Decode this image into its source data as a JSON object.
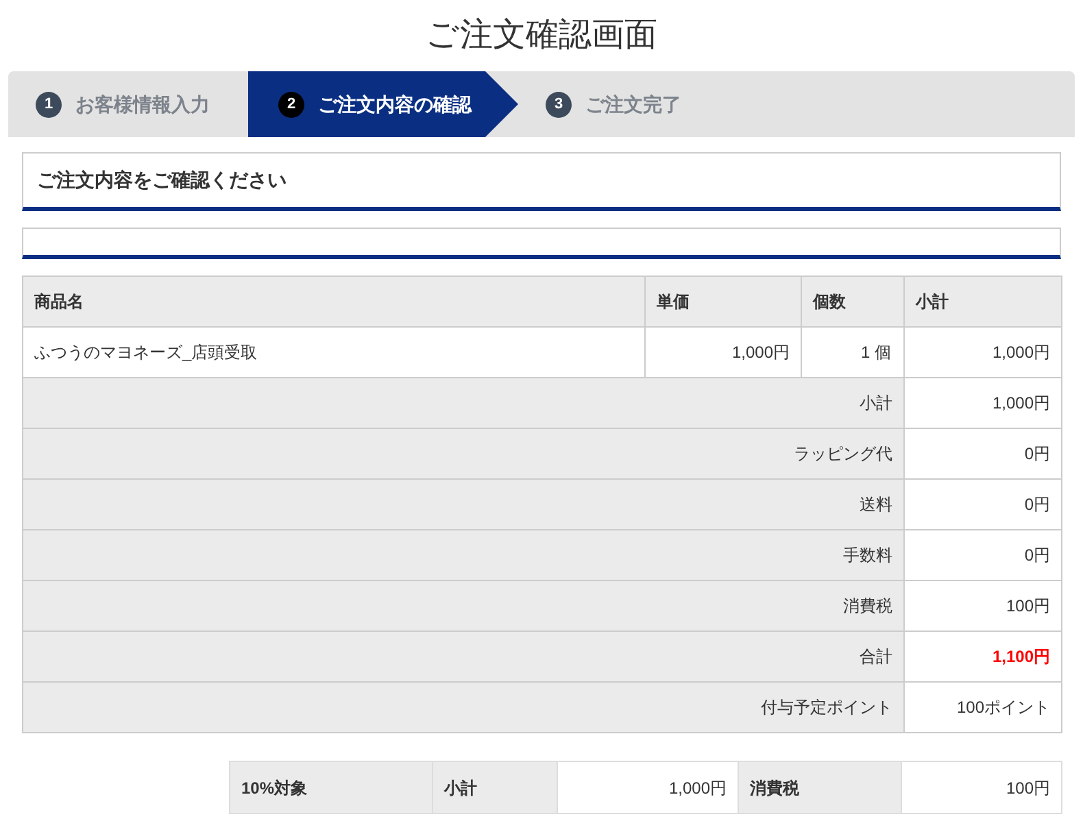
{
  "title": "ご注文確認画面",
  "steps": [
    {
      "number": "1",
      "label": "お客様情報入力",
      "selected": false
    },
    {
      "number": "2",
      "label": "ご注文内容の確認",
      "selected": true
    },
    {
      "number": "3",
      "label": "ご注文完了",
      "selected": false
    }
  ],
  "section_heading": "ご注文内容をご確認ください",
  "order_table": {
    "columns": [
      "商品名",
      "単価",
      "個数",
      "小計"
    ],
    "rows": [
      {
        "cells": [
          "ふつうのマヨネーズ_店頭受取",
          "1,000円",
          "1 個",
          "1,000円"
        ]
      }
    ],
    "summary": [
      {
        "label": "小計",
        "value": "1,000円",
        "emphasized": false
      },
      {
        "label": "ラッピング代",
        "value": "0円",
        "emphasized": false
      },
      {
        "label": "送料",
        "value": "0円",
        "emphasized": false
      },
      {
        "label": "手数料",
        "value": "0円",
        "emphasized": false
      },
      {
        "label": "消費税",
        "value": "100円",
        "emphasized": false
      },
      {
        "label": "合計",
        "value": "1,100円",
        "emphasized": true
      },
      {
        "label": "付与予定ポイント",
        "value": "100ポイント",
        "emphasized": false
      }
    ]
  },
  "tax_table": {
    "rate": "10%対象",
    "subtotal_label": "小計",
    "subtotal": "1,000円",
    "tax_label": "消費税",
    "tax": "100円"
  }
}
